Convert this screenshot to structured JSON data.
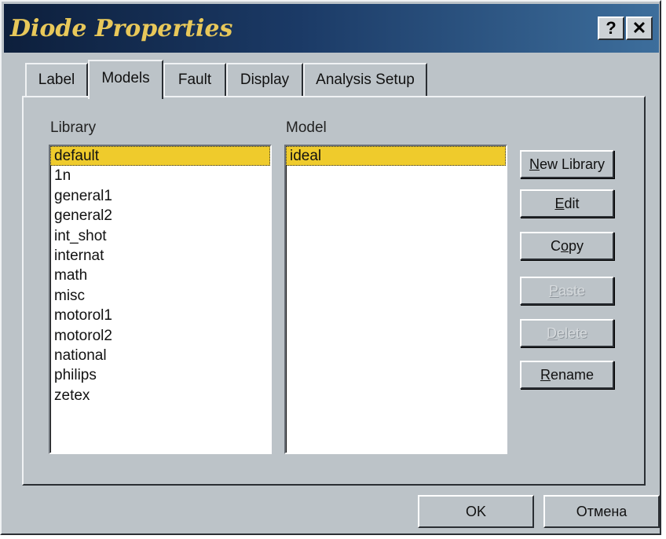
{
  "window": {
    "title": "Diode Properties",
    "help_label": "?",
    "close_label": "✕"
  },
  "tabs": [
    {
      "label": "Label"
    },
    {
      "label": "Models",
      "active": true
    },
    {
      "label": "Fault"
    },
    {
      "label": "Display"
    },
    {
      "label": "Analysis Setup"
    }
  ],
  "library": {
    "label": "Library",
    "items": [
      "default",
      "1n",
      "general1",
      "general2",
      "int_shot",
      "internat",
      "math",
      "misc",
      "motorol1",
      "motorol2",
      "national",
      "philips",
      "zetex"
    ],
    "selected": "default"
  },
  "model": {
    "label": "Model",
    "items": [
      "ideal"
    ],
    "selected": "ideal"
  },
  "buttons": {
    "new_library": {
      "mnemonic": "N",
      "rest": "ew Library"
    },
    "edit": {
      "mnemonic": "E",
      "rest": "dit"
    },
    "copy": {
      "pre": "C",
      "mnemonic": "o",
      "rest": "py"
    },
    "paste": {
      "mnemonic": "P",
      "rest": "aste",
      "disabled": true
    },
    "delete": {
      "mnemonic": "D",
      "rest": "elete",
      "disabled": true
    },
    "rename": {
      "mnemonic": "R",
      "rest": "ename"
    }
  },
  "footer": {
    "ok_label": "OK",
    "cancel_label": "Отмена"
  },
  "colors": {
    "selection": "#efcb2c",
    "title_text": "#e8c85a",
    "dialog_bg": "#bcc3c8"
  }
}
